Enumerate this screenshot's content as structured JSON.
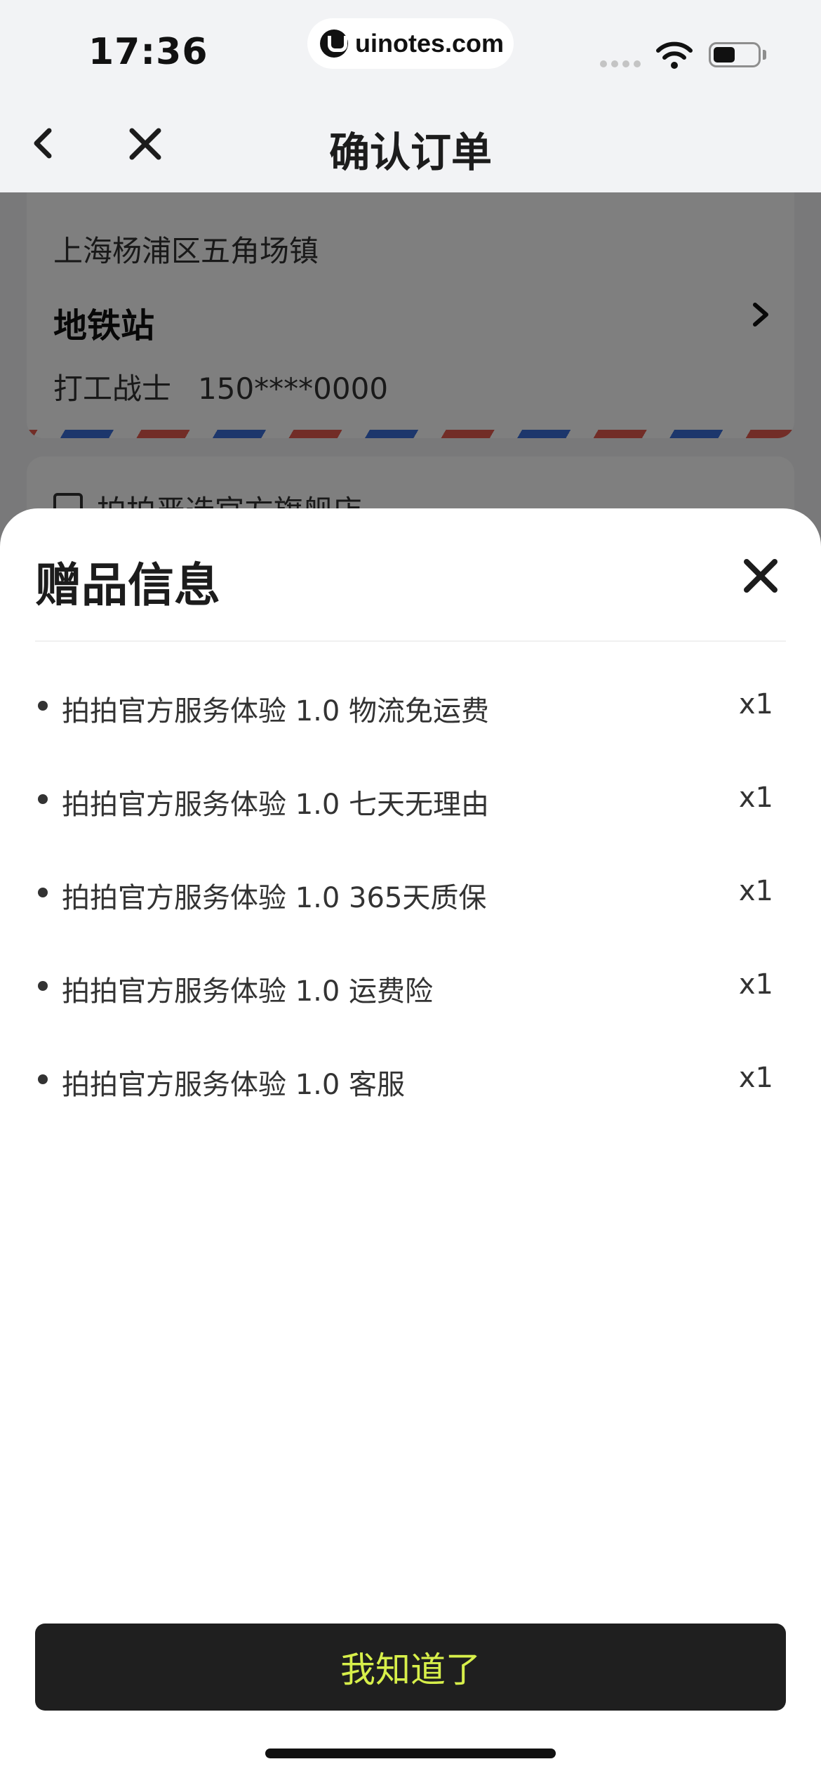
{
  "status_bar": {
    "time": "17:36",
    "watermark": "uinotes.com",
    "icons": [
      "signal-icon",
      "wifi-icon",
      "battery-icon"
    ]
  },
  "nav": {
    "title": "确认订单",
    "back_icon": "chevron-left-icon",
    "close_icon": "close-icon"
  },
  "address": {
    "region": "上海杨浦区五角场镇",
    "detail": "地铁站",
    "contact_name": "打工战士",
    "contact_phone": "150****0000",
    "arrow_icon": "chevron-right-icon"
  },
  "store": {
    "name": "拍拍严选官方旗舰店",
    "icon": "store-icon"
  },
  "gift_sheet": {
    "title": "赠品信息",
    "close_icon": "close-icon",
    "items": [
      {
        "name": "拍拍官方服务体验 1.0 物流免运费",
        "qty": "x1"
      },
      {
        "name": "拍拍官方服务体验 1.0 七天无理由",
        "qty": "x1"
      },
      {
        "name": "拍拍官方服务体验 1.0 365天质保",
        "qty": "x1"
      },
      {
        "name": "拍拍官方服务体验 1.0 运费险",
        "qty": "x1"
      },
      {
        "name": "拍拍官方服务体验 1.0 客服",
        "qty": "x1"
      }
    ],
    "confirm_label": "我知道了"
  },
  "colors": {
    "background": "#f2f3f5",
    "sheet": "#ffffff",
    "button_bg": "#1f1f1f",
    "button_text": "#d7ef4a",
    "stripe_red": "#e55a4e",
    "stripe_blue": "#3a6fd8"
  }
}
